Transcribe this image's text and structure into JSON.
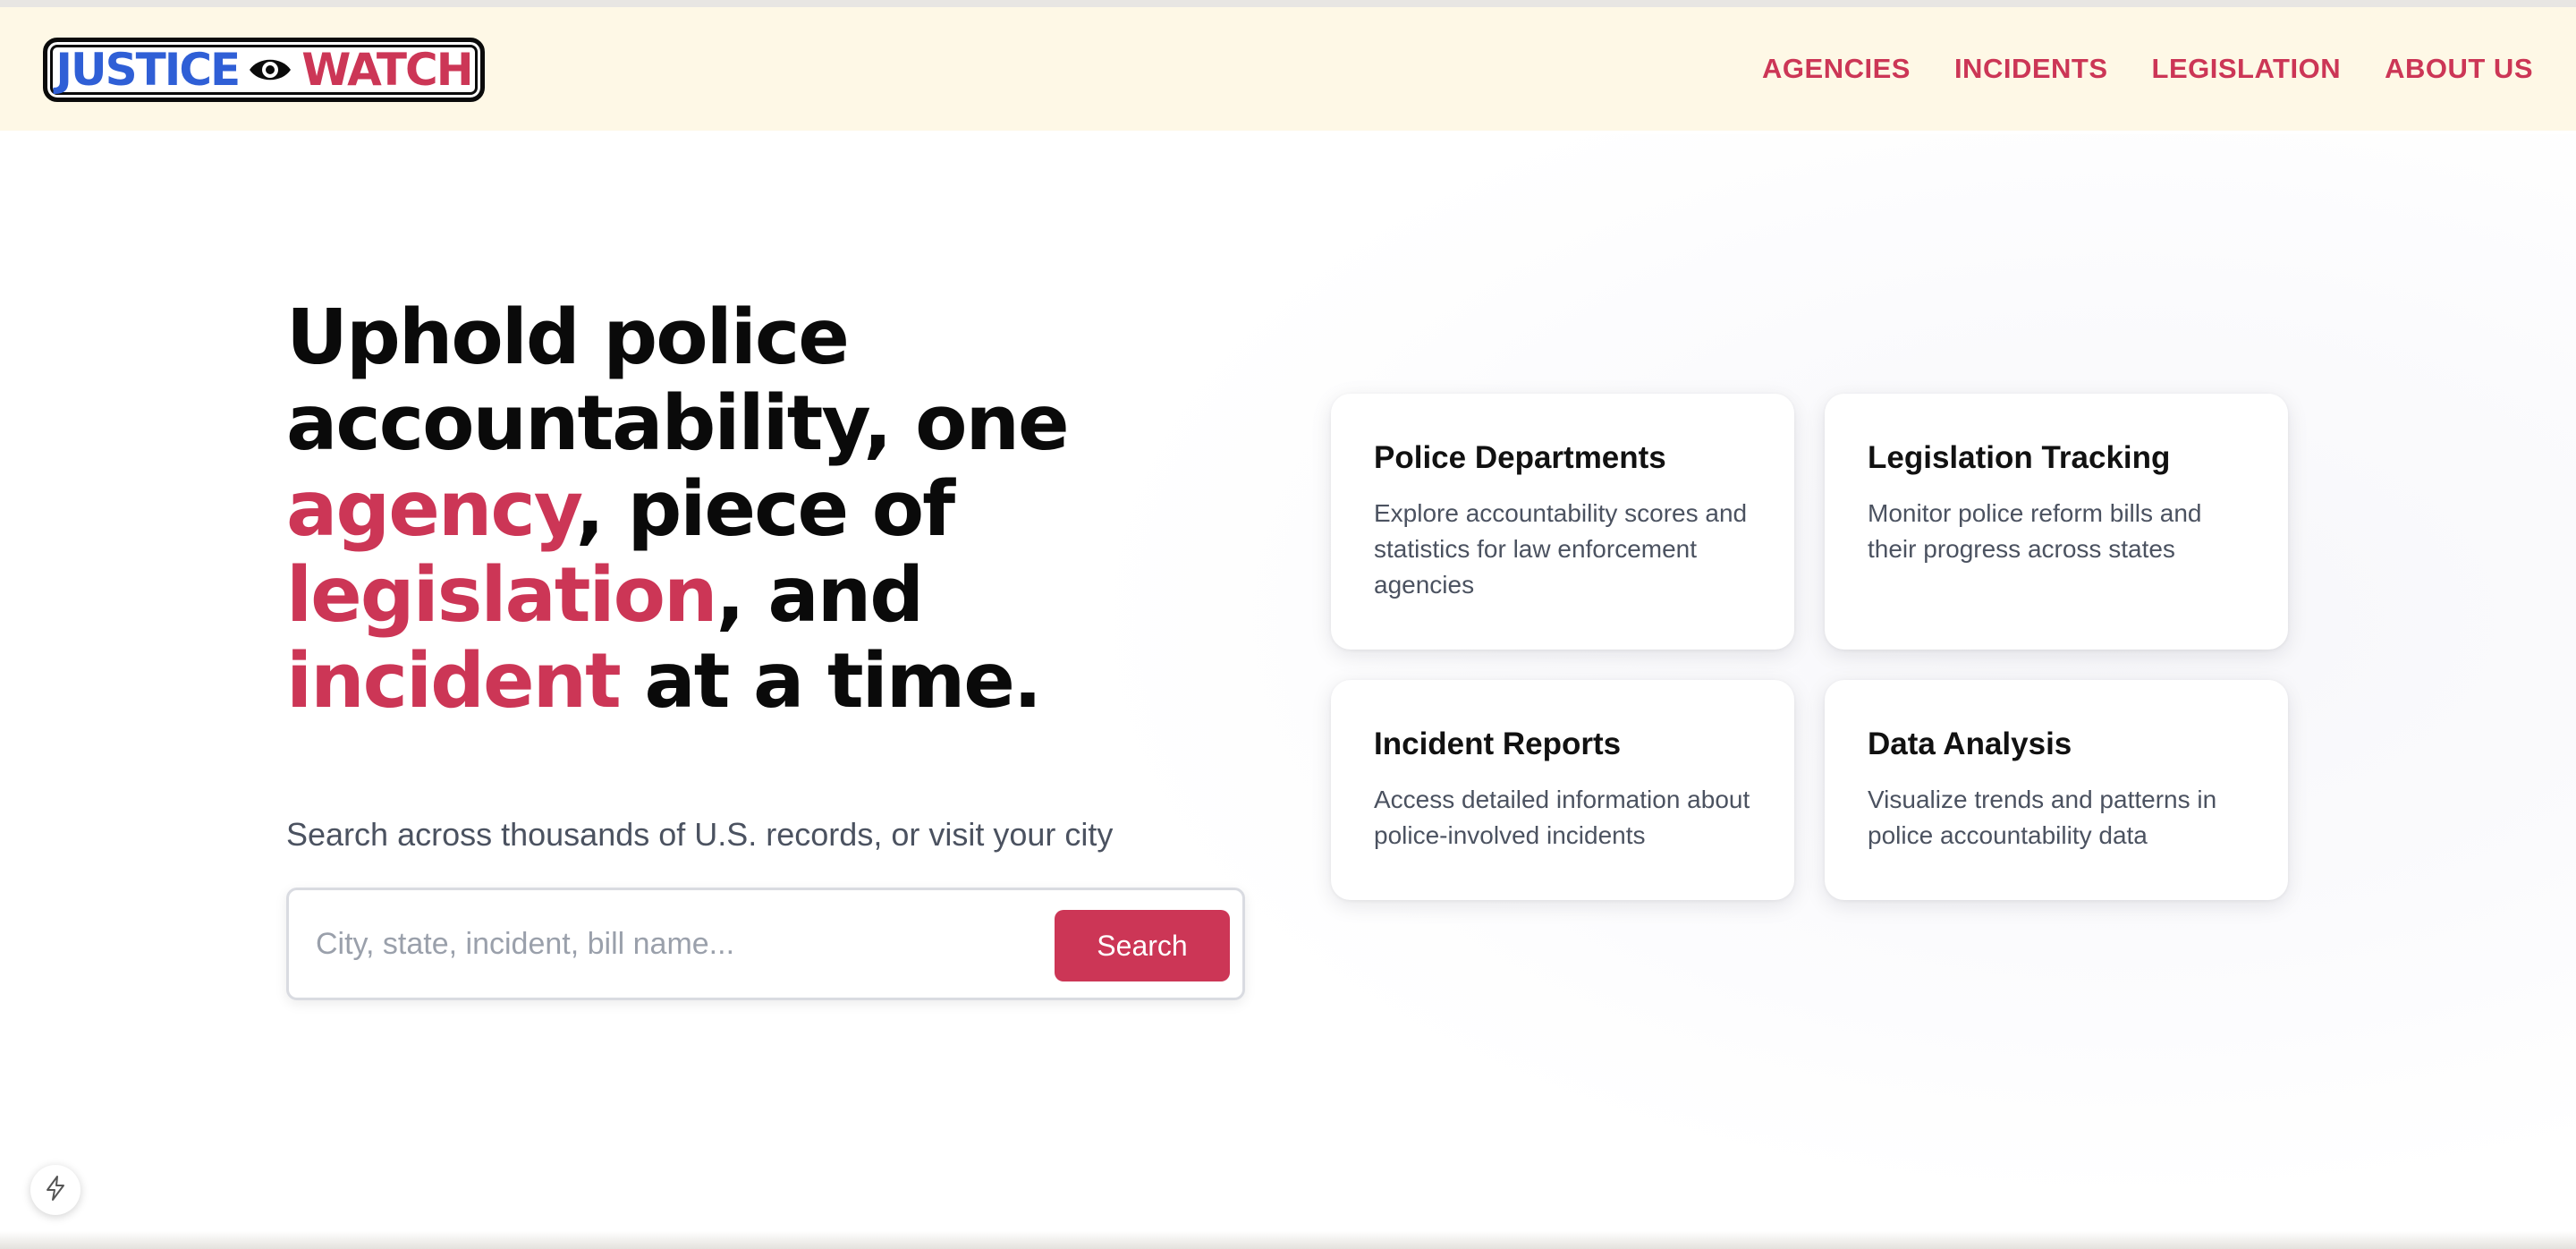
{
  "logo": {
    "word_1": "JUSTICE",
    "word_2": "WATCH",
    "icon": "eye-icon"
  },
  "nav": {
    "items": [
      {
        "label": "AGENCIES"
      },
      {
        "label": "INCIDENTS"
      },
      {
        "label": "LEGISLATION"
      },
      {
        "label": "ABOUT US"
      }
    ]
  },
  "hero": {
    "headline": {
      "part_1": "Uphold police accountability, one ",
      "accent_1": "agency",
      "part_2": ", piece of ",
      "accent_2": "legislation",
      "part_3": ", and ",
      "accent_3": "incident",
      "part_4": " at a time."
    },
    "subtitle": "Search across thousands of U.S. records, or visit your city"
  },
  "search": {
    "placeholder": "City, state, incident, bill name...",
    "value": "",
    "button_label": "Search"
  },
  "cards": [
    {
      "title": "Police Departments",
      "description": "Explore accountability scores and statistics for law enforcement agencies"
    },
    {
      "title": "Legislation Tracking",
      "description": "Monitor police reform bills and their progress across states"
    },
    {
      "title": "Incident Reports",
      "description": "Access detailed information about police-involved incidents"
    },
    {
      "title": "Data Analysis",
      "description": "Visualize trends and patterns in police accountability data"
    }
  ],
  "floating_button": {
    "icon": "lightning-icon"
  },
  "colors": {
    "brand_red": "#cc3656",
    "brand_blue": "#2f5fd6",
    "nav_background": "#fef8e6"
  }
}
